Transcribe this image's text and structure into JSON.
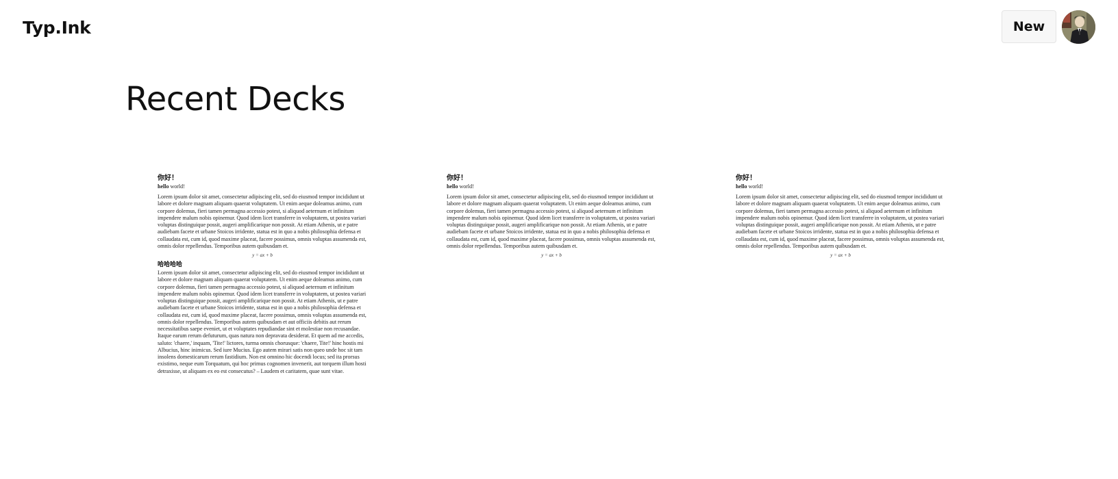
{
  "header": {
    "brand": "Typ.Ink",
    "new_label": "New",
    "avatar_icon": "user-avatar-icon"
  },
  "main": {
    "title": "Recent Decks",
    "decks": [
      {
        "heading": "你好！",
        "subtitle_bold": "hello",
        "subtitle_rest": " world!",
        "paragraph": "Lorem ipsum dolor sit amet, consectetur adipiscing elit, sed do eiusmod tempor incididunt ut labore et dolore magnam aliquam quaerat voluptatem. Ut enim aeque doleamus animo, cum corpore dolemus, fieri tamen permagna accessio potest, si aliquod aeternum et infinitum impendere malum nobis opinemur. Quod idem licet transferre in voluptatem, ut postea variari voluptas distinguique possit, augeri amplificarique non possit. At etiam Athenis, ut e patre audiebam facete et urbane Stoicos irridente, statua est in quo a nobis philosophia defensa et collaudata est, cum id, quod maxime placeat, facere possimus, omnis voluptas assumenda est, omnis dolor repellendus. Temporibus autem quibusdam et.",
        "formula": "y = ax + b",
        "heading2": "哈哈哈哈",
        "paragraph2": "Lorem ipsum dolor sit amet, consectetur adipiscing elit, sed do eiusmod tempor incididunt ut labore et dolore magnam aliquam quaerat voluptatem. Ut enim aeque doleamus animo, cum corpore dolemus, fieri tamen permagna accessio potest, si aliquod aeternum et infinitum impendere malum nobis opinemur. Quod idem licet transferre in voluptatem, ut postea variari voluptas distinguique possit, augeri amplificarique non possit. At etiam Athenis, ut e patre audiebam facete et urbane Stoicos irridente, statua est in quo a nobis philosophia defensa et collaudata est, cum id, quod maxime placeat, facere possimus, omnis voluptas assumenda est, omnis dolor repellendus. Temporibus autem quibusdam et aut officiis debitis aut rerum necessitatibus saepe eveniet, ut et voluptates repudiandae sint et molestiae non recusandae. Itaque earum rerum defuturum, quas natura non depravata desiderat. Et quem ad me accedis, saluto: 'chaere,' inquam, 'Tite!' lictores, turma omnis chorusque: 'chaere, Tite!' hinc hostis mi Albucius, hinc inimicus. Sed iure Mucius. Ego autem mirari satis non queo unde hoc sit tam insolens domesticarum rerum fastidium. Non est omnino hic docendi locus; sed ita prorsus existimo, neque eum Torquatum, qui hoc primus cognomen invenerit, aut torquem illum hosti detraxisse, ut aliquam ex eo est consecutus? – Laudem et caritatem, quae sunt vitae."
      },
      {
        "heading": "你好！",
        "subtitle_bold": "hello",
        "subtitle_rest": " world!",
        "paragraph": "Lorem ipsum dolor sit amet, consectetur adipiscing elit, sed do eiusmod tempor incididunt ut labore et dolore magnam aliquam quaerat voluptatem. Ut enim aeque doleamus animo, cum corpore dolemus, fieri tamen permagna accessio potest, si aliquod aeternum et infinitum impendere malum nobis opinemur. Quod idem licet transferre in voluptatem, ut postea variari voluptas distinguique possit, augeri amplificarique non possit. At etiam Athenis, ut e patre audiebam facete et urbane Stoicos irridente, statua est in quo a nobis philosophia defensa et collaudata est, cum id, quod maxime placeat, facere possimus, omnis voluptas assumenda est, omnis dolor repellendus. Temporibus autem quibusdam et.",
        "formula": "y = ax + b"
      },
      {
        "heading": "你好！",
        "subtitle_bold": "hello",
        "subtitle_rest": " world!",
        "paragraph": "Lorem ipsum dolor sit amet, consectetur adipiscing elit, sed do eiusmod tempor incididunt ut labore et dolore magnam aliquam quaerat voluptatem. Ut enim aeque doleamus animo, cum corpore dolemus, fieri tamen permagna accessio potest, si aliquod aeternum et infinitum impendere malum nobis opinemur. Quod idem licet transferre in voluptatem, ut postea variari voluptas distinguique possit, augeri amplificarique non possit. At etiam Athenis, ut e patre audiebam facete et urbane Stoicos irridente, statua est in quo a nobis philosophia defensa et collaudata est, cum id, quod maxime placeat, facere possimus, omnis voluptas assumenda est, omnis dolor repellendus. Temporibus autem quibusdam et.",
        "formula": "y = ax + b"
      }
    ]
  }
}
